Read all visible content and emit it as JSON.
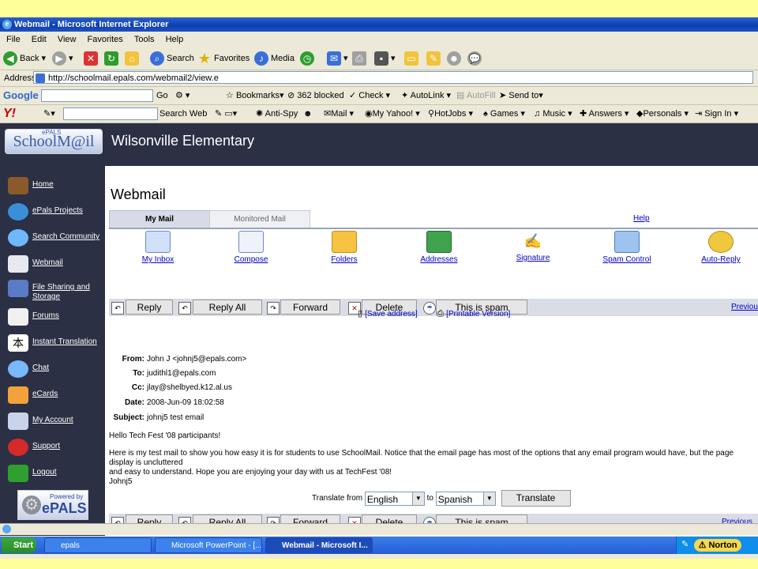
{
  "window": {
    "title": "Webmail - Microsoft Internet Explorer"
  },
  "menu": [
    "File",
    "Edit",
    "View",
    "Favorites",
    "Tools",
    "Help"
  ],
  "toolbar": {
    "back": "Back",
    "search": "Search",
    "favorites": "Favorites",
    "media": "Media"
  },
  "address": {
    "label": "Address",
    "url": "http://schoolmail.epals.com/webmail2/view.e"
  },
  "google": {
    "logo": "Google",
    "go": "Go",
    "bookmarks": "Bookmarks",
    "blocked": "362 blocked",
    "check": "Check",
    "autolink": "AutoLink",
    "autofill": "AutoFill",
    "sendto": "Send to"
  },
  "yahoo": {
    "logo": "Y!",
    "search_web": "Search Web",
    "antispy": "Anti-Spy",
    "mail": "Mail",
    "my_yahoo": "My Yahoo!",
    "hotjobs": "HotJobs",
    "games": "Games",
    "music": "Music",
    "answers": "Answers",
    "personals": "Personals",
    "sign_in": "Sign In"
  },
  "site": {
    "logo_small": "ePALS",
    "logo": "SchoolM@il",
    "school_name": "Wilsonville Elementary"
  },
  "sidebar": {
    "items": [
      {
        "label": "Home"
      },
      {
        "label": "ePals Projects"
      },
      {
        "label": "Search Community"
      },
      {
        "label": "Webmail"
      },
      {
        "label": "File Sharing and Storage"
      },
      {
        "label": "Forums"
      },
      {
        "label": "Instant Translation"
      },
      {
        "label": "Chat"
      },
      {
        "label": "eCards"
      },
      {
        "label": "My Account"
      },
      {
        "label": "Support"
      },
      {
        "label": "Logout"
      }
    ],
    "powered_1": "Powered by",
    "powered_2": "ePALS"
  },
  "main": {
    "title": "Webmail",
    "tabs": {
      "my_mail": "My Mail",
      "monitored": "Monitored Mail",
      "help": "Help"
    },
    "tools": [
      "My Inbox",
      "Compose",
      "Folders",
      "Addresses",
      "Signature",
      "Spam Control",
      "Auto-Reply"
    ],
    "actions": {
      "reply": "Reply",
      "reply_all": "Reply All",
      "forward": "Forward",
      "delete": "Delete",
      "spam": "This is spam",
      "previous": "Previous"
    },
    "save_address": "[Save address]",
    "printable": "[Printable Version]"
  },
  "message": {
    "from_label": "From:",
    "from": "John J <johnj5@epals.com>",
    "to_label": "To:",
    "to": "judithl1@epals.com",
    "cc_label": "Cc:",
    "cc": "jlay@shelbyed.k12.al.us",
    "date_label": "Date:",
    "date": "2008-Jun-09 18:02:58",
    "subject_label": "Subject:",
    "subject": "johnj5 test email",
    "greeting": "Hello Tech Fest '08 participants!",
    "body": "Here is my test mail to show you how easy it is for students to use SchoolMail.  Notice that the email page has most of the options that any email program would have, but the page display is uncluttered\nand easy to understand.  Hope you are enjoying your day with us at TechFest '08!\nJohnj5"
  },
  "translate": {
    "label_from": "Translate from",
    "from_lang": "English",
    "label_to": "to",
    "to_lang": "Spanish",
    "button": "Translate"
  },
  "taskbar": {
    "start": "Start",
    "tasks": [
      "epals",
      "Microsoft PowerPoint - [...",
      "Webmail - Microsoft I..."
    ],
    "norton": "Norton"
  }
}
